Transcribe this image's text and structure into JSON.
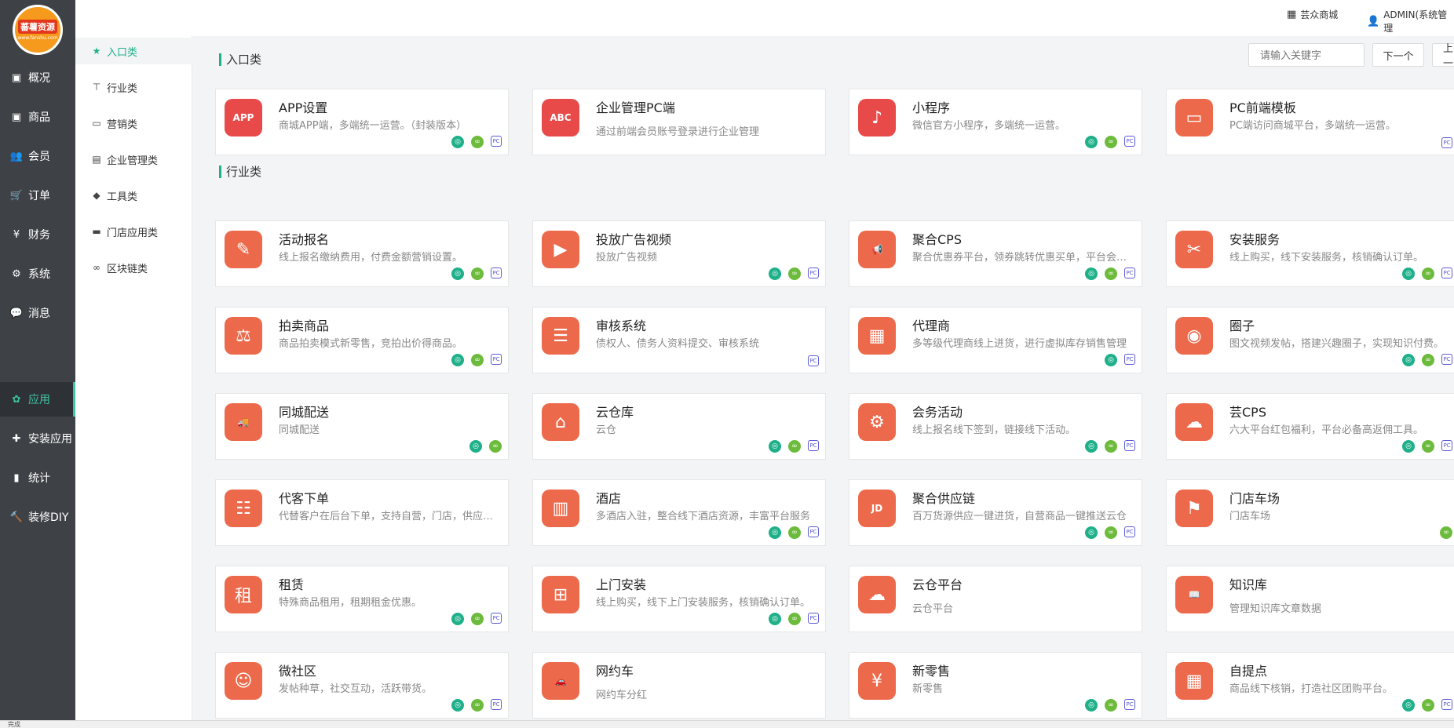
{
  "logo": {
    "title": "蕃薯资源",
    "subtitle": "www.fanshu.com"
  },
  "nav": [
    {
      "label": "概况",
      "icon": "▣",
      "icon_name": "dashboard-icon"
    },
    {
      "label": "商品",
      "icon": "▣",
      "icon_name": "goods-icon"
    },
    {
      "label": "会员",
      "icon": "👥",
      "icon_name": "members-icon"
    },
    {
      "label": "订单",
      "icon": "🛒",
      "icon_name": "cart-icon"
    },
    {
      "label": "财务",
      "icon": "¥",
      "icon_name": "yen-icon"
    },
    {
      "label": "系统",
      "icon": "⚙",
      "icon_name": "gear-icon"
    },
    {
      "label": "消息",
      "icon": "💬",
      "icon_name": "message-icon"
    },
    {
      "label": "应用",
      "icon": "✿",
      "icon_name": "apps-icon",
      "active": true
    },
    {
      "label": "安装应用",
      "icon": "✚",
      "icon_name": "install-icon"
    },
    {
      "label": "统计",
      "icon": "▮",
      "icon_name": "chart-icon"
    },
    {
      "label": "装修DIY",
      "icon": "🔨",
      "icon_name": "hammer-icon"
    }
  ],
  "subnav": [
    {
      "label": "入口类",
      "icon": "★",
      "icon_name": "star-icon",
      "active": true
    },
    {
      "label": "行业类",
      "icon": "⊤",
      "icon_name": "sitemap-icon"
    },
    {
      "label": "营销类",
      "icon": "▭",
      "icon_name": "money-icon"
    },
    {
      "label": "企业管理类",
      "icon": "▤",
      "icon_name": "briefcase-icon"
    },
    {
      "label": "工具类",
      "icon": "◆",
      "icon_name": "tags-icon"
    },
    {
      "label": "门店应用类",
      "icon": "▬",
      "icon_name": "truck-icon"
    },
    {
      "label": "区块链类",
      "icon": "∞",
      "icon_name": "chain-icon"
    }
  ],
  "header": {
    "store_label": "芸众商城",
    "store_icon": "▦",
    "user_label": "ADMIN(系统管理",
    "user_icon": "👤"
  },
  "toolbar": {
    "search_placeholder": "请输入关键字",
    "next_label": "下一个",
    "prev_label": "上一"
  },
  "sections": [
    {
      "title": "入口类"
    },
    {
      "title": "行业类"
    }
  ],
  "cards": [
    {
      "name": "APP设置",
      "desc": "商城APP端，多端统一运营。（封装版本）",
      "glyph": "APP",
      "icon_name": "app-icon",
      "red": true,
      "badges": [
        "mini",
        "link",
        "pc"
      ]
    },
    {
      "name": "企业管理PC端",
      "desc": "通过前端会员账号登录进行企业管理",
      "glyph": "ABC",
      "icon_name": "abc-icon",
      "red": true,
      "low": true,
      "badges": []
    },
    {
      "name": "小程序",
      "desc": "微信官方小程序，多端统一运营。",
      "glyph": "♪",
      "icon_name": "mini-program-icon",
      "red": true,
      "badges": [
        "mini",
        "link",
        "pc"
      ]
    },
    {
      "name": "PC前端模板",
      "desc": "PC端访问商城平台，多端统一运营。",
      "glyph": "▭",
      "icon_name": "monitor-icon",
      "badges": [
        "pc"
      ]
    },
    {
      "name": "活动报名",
      "desc": "线上报名缴纳费用，付费金额营销设置。",
      "glyph": "✎",
      "icon_name": "signup-icon",
      "badges": [
        "mini",
        "link",
        "pc"
      ]
    },
    {
      "name": "投放广告视频",
      "desc": "投放广告视频",
      "glyph": "▶",
      "icon_name": "video-icon",
      "badges": [
        "mini",
        "link",
        "pc"
      ]
    },
    {
      "name": "聚合CPS",
      "desc": "聚合优惠券平台，领券跳转优惠买单，平台会员权益",
      "glyph": "📢",
      "icon_name": "megaphone-icon",
      "badges": [
        "mini",
        "link",
        "pc"
      ]
    },
    {
      "name": "安装服务",
      "desc": "线上购买，线下安装服务，核销确认订单。",
      "glyph": "✂",
      "icon_name": "tools-icon",
      "badges": [
        "mini",
        "link",
        "pc"
      ]
    },
    {
      "name": "拍卖商品",
      "desc": "商品拍卖模式新零售，竞拍出价得商品。",
      "glyph": "⚖",
      "icon_name": "auction-icon",
      "badges": [
        "mini",
        "link",
        "pc"
      ]
    },
    {
      "name": "审核系统",
      "desc": "债权人、债务人资料提交、审核系统",
      "glyph": "☰",
      "icon_name": "audit-icon",
      "badges": [
        "pc"
      ]
    },
    {
      "name": "代理商",
      "desc": "多等级代理商线上进货，进行虚拟库存销售管理",
      "glyph": "▦",
      "icon_name": "building-icon",
      "badges": [
        "mini",
        "pc"
      ]
    },
    {
      "name": "圈子",
      "desc": "图文视频发帖，搭建兴趣圈子，实现知识付费。",
      "glyph": "◉",
      "icon_name": "planet-icon",
      "badges": [
        "mini",
        "link",
        "pc"
      ]
    },
    {
      "name": "同城配送",
      "desc": "同城配送",
      "glyph": "🚚",
      "icon_name": "delivery-icon",
      "badges": [
        "mini",
        "link"
      ]
    },
    {
      "name": "云仓库",
      "desc": "云仓",
      "glyph": "⌂",
      "icon_name": "warehouse-icon",
      "badges": [
        "mini",
        "link",
        "pc"
      ]
    },
    {
      "name": "会务活动",
      "desc": "线上报名线下签到，链接线下活动。",
      "glyph": "⚙",
      "icon_name": "conference-icon",
      "badges": [
        "mini",
        "link",
        "pc"
      ]
    },
    {
      "name": "芸CPS",
      "desc": "六大平台红包福利，平台必备高返佣工具。",
      "glyph": "☁",
      "icon_name": "cloud-cps-icon",
      "badges": [
        "mini",
        "link",
        "pc"
      ]
    },
    {
      "name": "代客下单",
      "desc": "代替客户在后台下单，支持自营，门店，供应商商品",
      "glyph": "☷",
      "icon_name": "proxy-order-icon",
      "badges": []
    },
    {
      "name": "酒店",
      "desc": "多酒店入驻，整合线下酒店资源，丰富平台服务",
      "glyph": "▥",
      "icon_name": "hotel-icon",
      "badges": [
        "mini",
        "link",
        "pc"
      ]
    },
    {
      "name": "聚合供应链",
      "desc": "百万货源供应一键进货，自营商品一键推送云仓",
      "glyph": "JD",
      "icon_name": "jd-icon",
      "badges": [
        "mini",
        "link",
        "pc"
      ]
    },
    {
      "name": "门店车场",
      "desc": "门店车场",
      "glyph": "⚑",
      "icon_name": "flag-icon",
      "badges": [
        "link"
      ]
    },
    {
      "name": "租赁",
      "desc": "特殊商品租用，租期租金优惠。",
      "glyph": "租",
      "icon_name": "rent-icon",
      "badges": [
        "mini",
        "link",
        "pc"
      ]
    },
    {
      "name": "上门安装",
      "desc": "线上购买，线下上门安装服务，核销确认订单。",
      "glyph": "⊞",
      "icon_name": "onsite-install-icon",
      "badges": [
        "mini",
        "link",
        "pc"
      ]
    },
    {
      "name": "云仓平台",
      "desc": "云仓平台",
      "glyph": "☁",
      "icon_name": "cloud-platform-icon",
      "low": true,
      "badges": []
    },
    {
      "name": "知识库",
      "desc": "管理知识库文章数据",
      "glyph": "📖",
      "icon_name": "book-icon",
      "low": true,
      "badges": []
    },
    {
      "name": "微社区",
      "desc": "发帖种草，社交互动，活跃带货。",
      "glyph": "☺",
      "icon_name": "community-icon",
      "badges": [
        "mini",
        "link",
        "pc"
      ]
    },
    {
      "name": "网约车",
      "desc": "网约车分红",
      "glyph": "🚗",
      "icon_name": "car-icon",
      "low": true,
      "badges": []
    },
    {
      "name": "新零售",
      "desc": "新零售",
      "glyph": "¥",
      "icon_name": "retail-icon",
      "badges": [
        "mini",
        "link",
        "pc"
      ]
    },
    {
      "name": "自提点",
      "desc": "商品线下核销，打造社区团购平台。",
      "glyph": "▦",
      "icon_name": "pickup-icon",
      "badges": [
        "mini",
        "link",
        "pc"
      ]
    }
  ],
  "badge_glyphs": {
    "mini": "◎",
    "link": "∞",
    "pc": "PC"
  },
  "status": {
    "text": "完成"
  }
}
